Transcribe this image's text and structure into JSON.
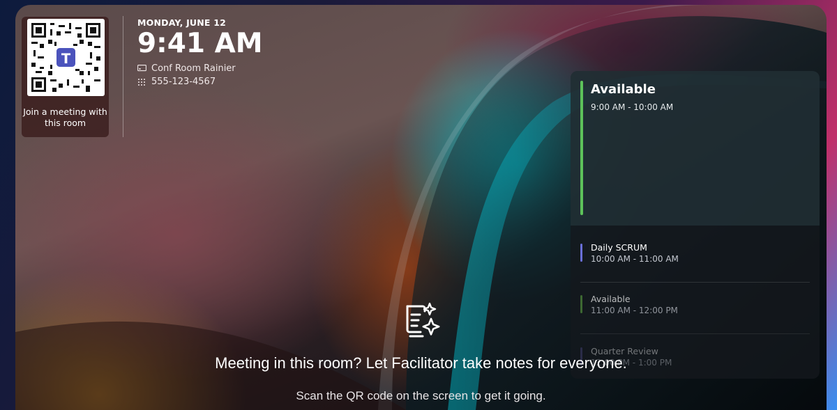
{
  "qr": {
    "label": "Join a meeting with this room"
  },
  "header": {
    "date": "MONDAY, JUNE 12",
    "time": "9:41 AM",
    "room_name": "Conf Room Rainier",
    "phone": "555-123-4567",
    "room_icon": "display-icon",
    "phone_icon": "dialpad-icon"
  },
  "schedule": {
    "current": {
      "title": "Available",
      "range": "9:00 AM - 10:00 AM",
      "color": "#5dc25a"
    },
    "slots": [
      {
        "title": "Daily SCRUM",
        "range": "10:00 AM - 11:00 AM",
        "color": "#6a6fd8"
      },
      {
        "title": "Available",
        "range": "11:00 AM - 12:00 PM",
        "color": "#4f8a3c"
      },
      {
        "title": "Quarter Review",
        "range": "12:00 PM - 1:00 PM",
        "color": "#4f4c8a"
      }
    ]
  },
  "cta": {
    "icon": "notes-sparkle-icon",
    "title": "Meeting in this room? Let Facilitator take notes for everyone.",
    "subtitle": "Scan the QR code on the screen to get it going."
  }
}
